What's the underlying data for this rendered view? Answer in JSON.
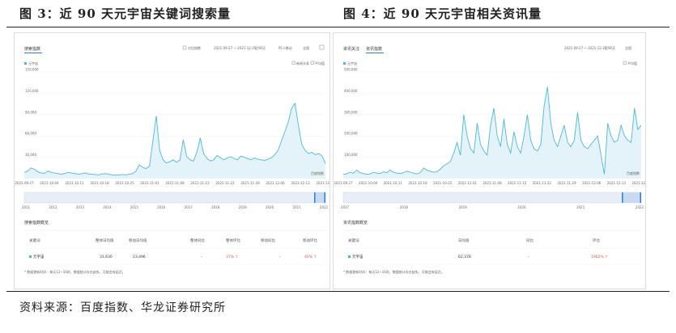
{
  "figure_left": {
    "title": "图 3：近 90 天元宇宙关键词搜索量",
    "panel": {
      "tab_active": "搜索指数",
      "controls": {
        "compare": "对比指数",
        "date_range": "2021-09-27 ~ 2021-12-25",
        "period": "近90天",
        "device": "PC+移动",
        "region": "全国"
      },
      "legend_label": "元宇宙",
      "toggles": [
        "新闻头条",
        "平均值"
      ],
      "bottom_years": [
        "2011",
        "2012",
        "2013",
        "2014",
        "2015",
        "2016",
        "2017",
        "2018",
        "2019",
        "2020",
        "2021",
        "2022"
      ],
      "summary_title": "搜索指数概览",
      "summary_headers": [
        "关键词",
        "整体日均值",
        "移动日均值",
        "整体同比",
        "整体环比",
        "移动同比",
        "移动环比"
      ],
      "summary_row": {
        "keyword": "元宇宙",
        "overall_avg": "31,630",
        "mobile_avg": "23,496",
        "overall_yoy": "-",
        "overall_mom": "37% ↑",
        "mobile_yoy": "-",
        "mobile_mom": "40% ↑"
      },
      "footnote": "* 数据更新时间：每天12~16时，数据统计存在缺失，可能会有延迟。"
    },
    "chart_data": {
      "type": "area",
      "title": "",
      "xlabel": "",
      "ylabel": "",
      "ylim": [
        0,
        170000
      ],
      "yticks": [
        "30,000",
        "60,000",
        "90,000",
        "120,000",
        "150,000"
      ],
      "xticks": [
        "2021-09-27",
        "2021-10-04",
        "2021-10-11",
        "2021-10-18",
        "2021-10-25",
        "2021-11-01",
        "2021-11-08",
        "2021-11-15",
        "2021-11-22",
        "2021-11-29",
        "2021-12-06",
        "2021-12-13",
        "2021-12-20"
      ],
      "series": [
        {
          "name": "元宇宙",
          "values": [
            10000,
            12000,
            17000,
            15000,
            11000,
            9000,
            8500,
            12000,
            10000,
            9000,
            8000,
            7000,
            8500,
            10000,
            9000,
            8000,
            7000,
            8000,
            9000,
            7500,
            7000,
            6500,
            6000,
            7500,
            8000,
            7000,
            6000,
            5500,
            6000,
            6500,
            6000,
            7000,
            8000,
            12000,
            22000,
            18000,
            16000,
            20000,
            60000,
            100000,
            45000,
            30000,
            25000,
            27000,
            30000,
            26000,
            30000,
            62000,
            35000,
            30000,
            28000,
            42000,
            65000,
            40000,
            32000,
            28000,
            30000,
            37000,
            33000,
            30000,
            33000,
            35000,
            32000,
            30000,
            36000,
            34000,
            32000,
            30000,
            33000,
            31000,
            30000,
            29000,
            31000,
            33000,
            38000,
            45000,
            60000,
            75000,
            90000,
            112000,
            120000,
            85000,
            55000,
            45000,
            40000,
            42000,
            38000,
            40000,
            36000,
            24000
          ]
        }
      ],
      "line_color": "#4db8d6",
      "fill_color": "#e3f3f9",
      "watermark": "百度指数"
    }
  },
  "figure_right": {
    "title": "图 4：近 90 天元宇宙相关资讯量",
    "panel": {
      "tabs": [
        "资讯关注",
        "资讯指数"
      ],
      "controls": {
        "date_range": "2021-09-27 ~ 2021-12-25",
        "period": "近90天",
        "region": "全国"
      },
      "legend_label": "元宇宙",
      "toggles": [
        "平均值"
      ],
      "bottom_years": [
        "2017",
        "2018",
        "2019",
        "2020",
        "2021",
        "2022"
      ],
      "summary_title": "资讯指数概览",
      "summary_headers": [
        "关键词",
        "日均值",
        "同比",
        "环比"
      ],
      "summary_row": {
        "keyword": "元宇宙",
        "daily_avg": "62,378",
        "yoy": "-",
        "mom": "1962% ↑"
      },
      "footnote": "* 数据更新时间：每天12~16时，数据统计存在缺失，可能会有延迟。"
    },
    "chart_data": {
      "type": "area",
      "title": "",
      "xlabel": "",
      "ylabel": "",
      "ylim": [
        0,
        500000
      ],
      "yticks": [
        "100,000",
        "200,000",
        "300,000",
        "400,000",
        "500,000"
      ],
      "xticks": [
        "2021-09-27",
        "2021-10-04",
        "2021-10-11",
        "2021-10-18",
        "2021-10-25",
        "2021-11-01",
        "2021-11-08",
        "2021-11-15",
        "2021-11-22",
        "2021-11-29",
        "2021-12-06",
        "2021-12-13",
        "2021-12-20"
      ],
      "series": [
        {
          "name": "元宇宙",
          "values": [
            20000,
            22000,
            30000,
            25000,
            40000,
            28000,
            24000,
            20000,
            22000,
            30000,
            26000,
            24000,
            32000,
            28000,
            40000,
            30000,
            26000,
            24000,
            28000,
            35000,
            30000,
            26000,
            22000,
            28000,
            50000,
            40000,
            35000,
            30000,
            32000,
            45000,
            60000,
            70000,
            80000,
            120000,
            170000,
            110000,
            300000,
            200000,
            140000,
            120000,
            260000,
            160000,
            130000,
            110000,
            250000,
            330000,
            200000,
            150000,
            280000,
            160000,
            120000,
            220000,
            150000,
            120000,
            200000,
            300000,
            180000,
            140000,
            130000,
            160000,
            340000,
            430000,
            260000,
            180000,
            150000,
            200000,
            250000,
            170000,
            150000,
            180000,
            310000,
            180000,
            150000,
            140000,
            160000,
            180000,
            200000,
            110000,
            20000,
            260000,
            200000,
            170000,
            180000,
            250000,
            200000,
            180000,
            170000,
            330000,
            230000,
            250000
          ]
        }
      ],
      "line_color": "#4db8d6",
      "fill_color": "#e3f3f9",
      "watermark": "百度指数"
    }
  },
  "source_text": "资料来源：百度指数、华龙证券研究所"
}
